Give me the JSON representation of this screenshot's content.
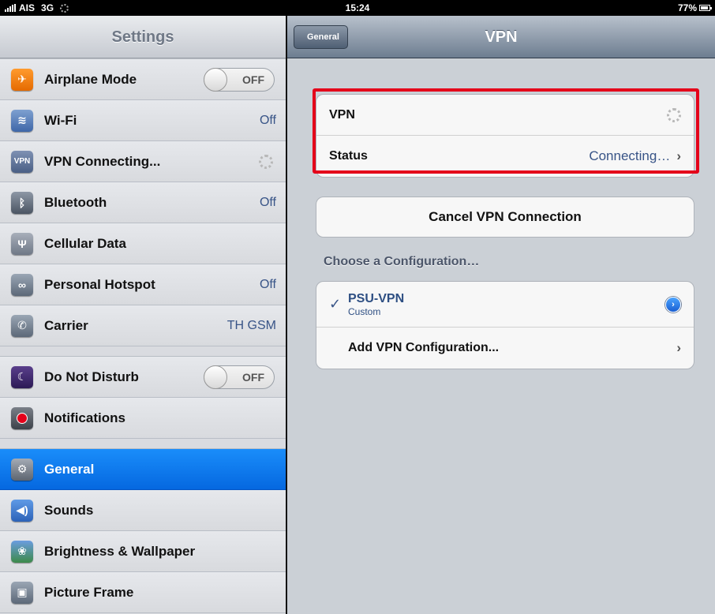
{
  "status_bar": {
    "carrier": "AIS",
    "network": "3G",
    "time": "15:24",
    "battery": "77%"
  },
  "master": {
    "title": "Settings",
    "groups": [
      {
        "items": [
          {
            "label": "Airplane Mode",
            "icon": "airplane-icon",
            "control": "toggle",
            "value": "OFF"
          },
          {
            "label": "Wi-Fi",
            "icon": "wifi-icon",
            "value": "Off"
          },
          {
            "label": "VPN Connecting...",
            "icon": "vpn-icon",
            "icon_text": "VPN",
            "control": "spinner"
          },
          {
            "label": "Bluetooth",
            "icon": "bluetooth-icon",
            "value": "Off"
          },
          {
            "label": "Cellular Data",
            "icon": "cellular-tower-icon"
          },
          {
            "label": "Personal Hotspot",
            "icon": "hotspot-icon",
            "value": "Off"
          },
          {
            "label": "Carrier",
            "icon": "phone-icon",
            "value": "TH GSM"
          }
        ]
      },
      {
        "items": [
          {
            "label": "Do Not Disturb",
            "icon": "moon-icon",
            "control": "toggle",
            "value": "OFF"
          },
          {
            "label": "Notifications",
            "icon": "notifications-icon"
          }
        ]
      },
      {
        "items": [
          {
            "label": "General",
            "icon": "gear-icon",
            "selected": true
          },
          {
            "label": "Sounds",
            "icon": "speaker-icon"
          },
          {
            "label": "Brightness & Wallpaper",
            "icon": "flower-icon"
          },
          {
            "label": "Picture Frame",
            "icon": "picture-frame-icon"
          }
        ]
      }
    ]
  },
  "detail": {
    "back_label": "General",
    "title": "VPN",
    "vpn_row": {
      "label": "VPN"
    },
    "status_row": {
      "label": "Status",
      "value": "Connecting…"
    },
    "cancel_label": "Cancel VPN Connection",
    "section_header": "Choose a Configuration…",
    "config": {
      "name": "PSU-VPN",
      "type": "Custom"
    },
    "add_label": "Add VPN Configuration..."
  },
  "colors": {
    "selected_row": "#0a74ec",
    "value_text": "#385487",
    "highlight_box": "#e4001a"
  }
}
